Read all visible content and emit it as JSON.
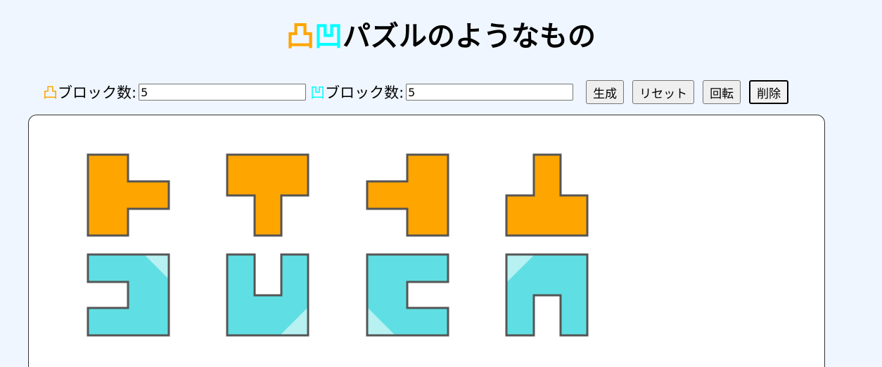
{
  "header": {
    "title_glyph_convex": "凸",
    "title_glyph_concave": "凹",
    "title_text": "パズルのようなもの"
  },
  "controls": {
    "convex_glyph": "凸",
    "convex_label": "ブロック数:",
    "convex_value": "5",
    "concave_glyph": "凹",
    "concave_label": "ブロック数:",
    "concave_value": "5",
    "generate_label": "生成",
    "reset_label": "リセット",
    "rotate_label": "回転",
    "delete_label": "削除"
  },
  "colors": {
    "convex_fill": "#ffa500",
    "concave_fill": "#5fdfe3",
    "piece_stroke": "#555555",
    "page_bg": "#eff6ff"
  },
  "pieces": {
    "convex": [
      {
        "name": "convex-piece-right"
      },
      {
        "name": "convex-piece-down"
      },
      {
        "name": "convex-piece-left"
      },
      {
        "name": "convex-piece-up"
      }
    ],
    "concave": [
      {
        "name": "concave-piece-left-notch"
      },
      {
        "name": "concave-piece-top-notch"
      },
      {
        "name": "concave-piece-right-notch"
      },
      {
        "name": "concave-piece-bottom-notch"
      }
    ]
  }
}
